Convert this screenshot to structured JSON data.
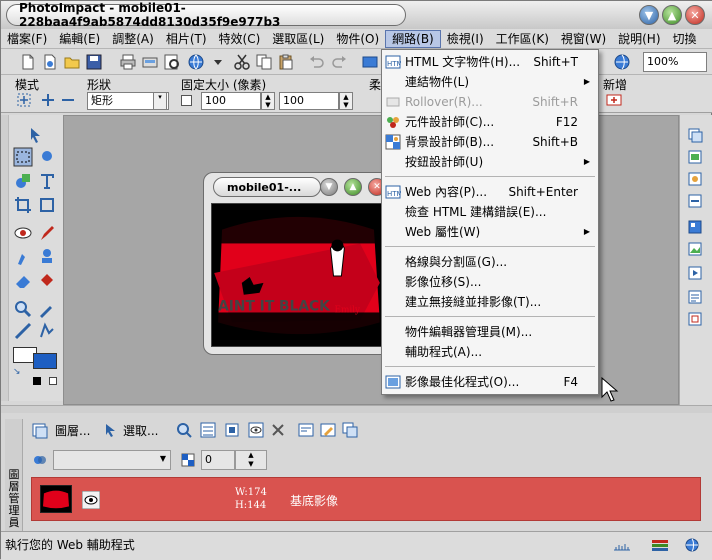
{
  "window": {
    "title": "PhotoImpact - mobile01-228baa4f9ab5874dd8130d35f9e977b3"
  },
  "menubar": {
    "items": [
      {
        "label": "檔案(F)"
      },
      {
        "label": "編輯(E)"
      },
      {
        "label": "調整(A)"
      },
      {
        "label": "相片(T)"
      },
      {
        "label": "特效(C)"
      },
      {
        "label": "選取區(L)"
      },
      {
        "label": "物件(O)"
      },
      {
        "label": "網路(B)",
        "active": true
      },
      {
        "label": "檢視(I)"
      },
      {
        "label": "工作區(K)"
      },
      {
        "label": "視窗(W)"
      },
      {
        "label": "說明(H)"
      },
      {
        "label": "切換"
      }
    ]
  },
  "toolbar": {
    "zoom": "100%"
  },
  "properties": {
    "mode_label": "模式",
    "shape_label": "形狀",
    "shape_value": "矩形",
    "fixed_size_label": "固定大小 (像素)",
    "width_value": "100",
    "height_value": "100",
    "soft_label": "柔",
    "new_label": "新增"
  },
  "document": {
    "title": "mobile01-...",
    "image_text_1": "AINT IT BLACK",
    "image_text_2": "Emily"
  },
  "network_menu": {
    "items": [
      {
        "label": "HTML 文字物件(H)...",
        "shortcut": "Shift+T",
        "icon": "html-text-icon"
      },
      {
        "label": "連結物件(L)",
        "shortcut": "",
        "submenu": true
      },
      {
        "label": "Rollover(R)...",
        "shortcut": "Shift+R",
        "disabled": true
      },
      {
        "label": "元件設計師(C)...",
        "shortcut": "F12",
        "icon": "component-designer-icon"
      },
      {
        "label": "背景設計師(B)...",
        "shortcut": "Shift+B",
        "icon": "background-designer-icon"
      },
      {
        "label": "按鈕設計師(U)",
        "shortcut": "",
        "submenu": true
      },
      {
        "label": "Web 內容(P)...",
        "shortcut": "Shift+Enter",
        "icon": "web-properties-icon"
      },
      {
        "label": "檢查 HTML 建構錯誤(E)...",
        "shortcut": ""
      },
      {
        "label": "Web 屬性(W)",
        "shortcut": "",
        "submenu": true
      },
      {
        "label": "格線與分割區(G)...",
        "shortcut": ""
      },
      {
        "label": "影像位移(S)...",
        "shortcut": ""
      },
      {
        "label": "建立無接縫並排影像(T)...",
        "shortcut": ""
      },
      {
        "label": "物件編輯器管理員(M)...",
        "shortcut": ""
      },
      {
        "label": "輔助程式(A)...",
        "shortcut": ""
      },
      {
        "label": "影像最佳化程式(O)...",
        "shortcut": "F4",
        "icon": "image-optimizer-icon"
      }
    ]
  },
  "layer_panel": {
    "side_label": "圖層管理員",
    "layers_button": "圖層...",
    "select_button": "選取...",
    "opacity_value": "0",
    "layer": {
      "wh": "W:174\nH:144",
      "name": "基底影像"
    }
  },
  "status": {
    "text": "執行您的 Web 輔助程式"
  },
  "colors": {
    "menu_highlight": "#b8c7e6",
    "layer_selected": "#d9534f",
    "image_red": "#e1001a"
  }
}
